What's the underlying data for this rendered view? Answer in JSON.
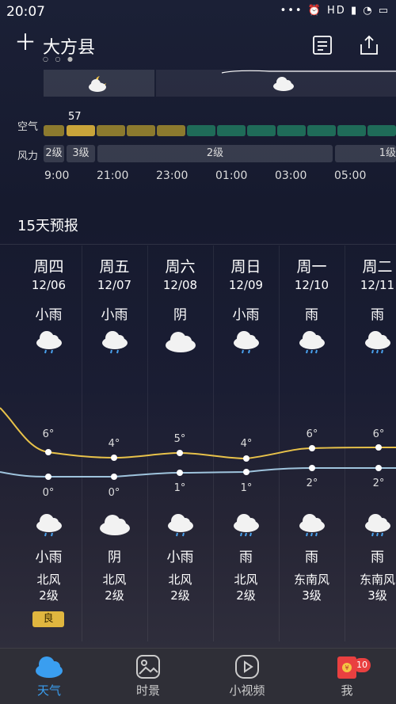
{
  "status_bar": {
    "time": "20:07",
    "icons_text": "••• ⏰ HD ▮ ◔ ▭"
  },
  "header": {
    "city": "大方县",
    "dots": "○ ○ ●"
  },
  "hourly": {
    "air_label": "空气",
    "air_value": "57",
    "wind_label": "风力",
    "wind_segments": [
      "2级",
      "3级",
      "2级",
      "1级"
    ],
    "times": [
      "9:00",
      "21:00",
      "23:00",
      "01:00",
      "03:00",
      "05:00"
    ]
  },
  "forecast": {
    "title": "15天预报",
    "days": [
      {
        "weekday": "周四",
        "date": "12/06",
        "day_cond": "小雨",
        "high": "6°",
        "low": "0°",
        "night_cond": "小雨",
        "wind_dir": "北风",
        "wind_level": "2级"
      },
      {
        "weekday": "周五",
        "date": "12/07",
        "day_cond": "小雨",
        "high": "4°",
        "low": "0°",
        "night_cond": "阴",
        "wind_dir": "北风",
        "wind_level": "2级"
      },
      {
        "weekday": "周六",
        "date": "12/08",
        "day_cond": "阴",
        "high": "5°",
        "low": "1°",
        "night_cond": "小雨",
        "wind_dir": "北风",
        "wind_level": "2级"
      },
      {
        "weekday": "周日",
        "date": "12/09",
        "day_cond": "小雨",
        "high": "4°",
        "low": "1°",
        "night_cond": "雨",
        "wind_dir": "北风",
        "wind_level": "2级"
      },
      {
        "weekday": "周一",
        "date": "12/10",
        "day_cond": "雨",
        "high": "6°",
        "low": "2°",
        "night_cond": "雨",
        "wind_dir": "东南风",
        "wind_level": "3级"
      },
      {
        "weekday": "周二",
        "date": "12/11",
        "day_cond": "雨",
        "high": "6°",
        "low": "2°",
        "night_cond": "雨",
        "wind_dir": "东南风",
        "wind_level": "3级"
      }
    ],
    "aq_badge": "良"
  },
  "nav": {
    "items": [
      {
        "label": "天气"
      },
      {
        "label": "时景"
      },
      {
        "label": "小视频"
      },
      {
        "label": "我"
      }
    ],
    "badge_count": "10"
  },
  "colors": {
    "accent": "#3a9ef0",
    "aq_good": "#e0b63f",
    "aq_excellent": "#1f6b58",
    "high_line": "#e8c24a",
    "low_line": "#9fc4dd"
  }
}
